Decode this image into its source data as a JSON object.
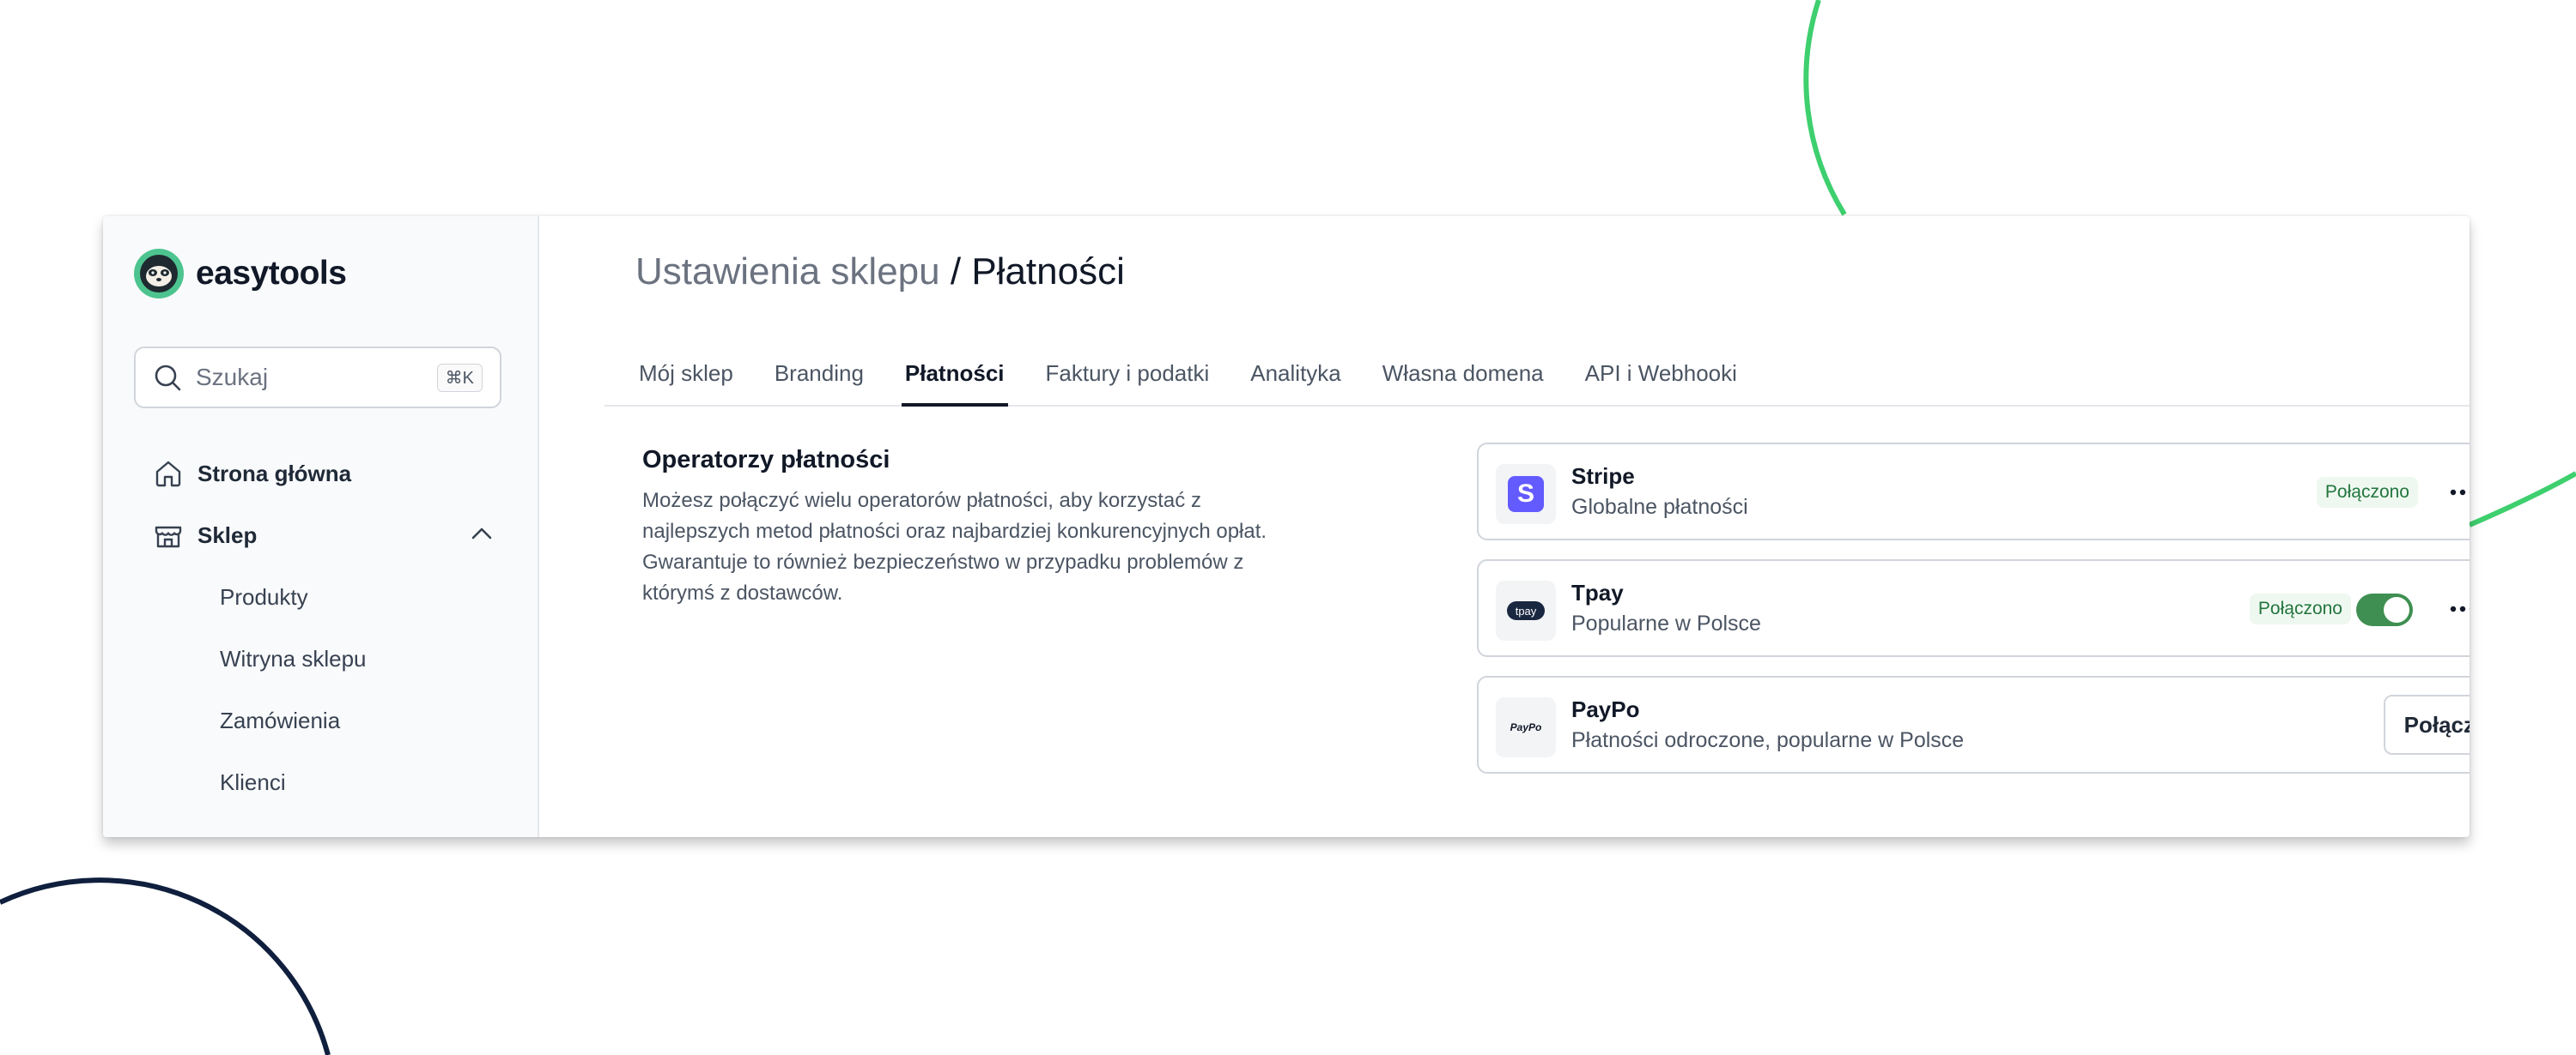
{
  "colors": {
    "green_arc": "#3ecf6e",
    "navy_arc": "#0f1f3d",
    "stripe_brand": "#635bff",
    "tpay_brand": "#1a2740",
    "toggle_on": "#3f8f52",
    "badge_bg": "#eef8f0",
    "badge_text": "#23753e"
  },
  "sidebar": {
    "logo_text": "easytools",
    "logo_icon": "sloth-logo-icon",
    "search": {
      "placeholder": "Szukaj",
      "shortcut": "⌘K",
      "icon": "search-icon"
    },
    "items": [
      {
        "label": "Strona główna",
        "icon": "home-icon"
      },
      {
        "label": "Sklep",
        "icon": "store-icon",
        "expanded": true
      }
    ],
    "sub_items": [
      {
        "label": "Produkty"
      },
      {
        "label": "Witryna sklepu"
      },
      {
        "label": "Zamówienia"
      },
      {
        "label": "Klienci"
      }
    ]
  },
  "main": {
    "breadcrumb": {
      "parent": "Ustawienia sklepu",
      "separator": "/",
      "current": "Płatności"
    },
    "tabs": [
      {
        "label": "Mój sklep",
        "active": false
      },
      {
        "label": "Branding",
        "active": false
      },
      {
        "label": "Płatności",
        "active": true
      },
      {
        "label": "Faktury i podatki",
        "active": false
      },
      {
        "label": "Analityka",
        "active": false
      },
      {
        "label": "Własna domena",
        "active": false
      },
      {
        "label": "API i Webhooki",
        "active": false
      }
    ],
    "section": {
      "title": "Operatorzy płatności",
      "description": "Możesz połączyć wielu operatorów płatności, aby korzystać z najlepszych metod płatności oraz najbardziej konkurencyjnych opłat. Gwarantuje to również bezpieczeństwo w przypadku problemów z którymś z dostawców."
    },
    "providers": [
      {
        "name": "Stripe",
        "description": "Globalne płatności",
        "logo_text": "S",
        "status": "Połączono",
        "enabled": null,
        "action": null
      },
      {
        "name": "Tpay",
        "description": "Popularne w Polsce",
        "logo_text": "tpay",
        "status": "Połączono",
        "enabled": true,
        "action": null
      },
      {
        "name": "PayPo",
        "description": "Płatności odroczone, popularne w Polsce",
        "logo_text": "PayPo",
        "status": null,
        "enabled": null,
        "action": "Połącz"
      }
    ]
  }
}
